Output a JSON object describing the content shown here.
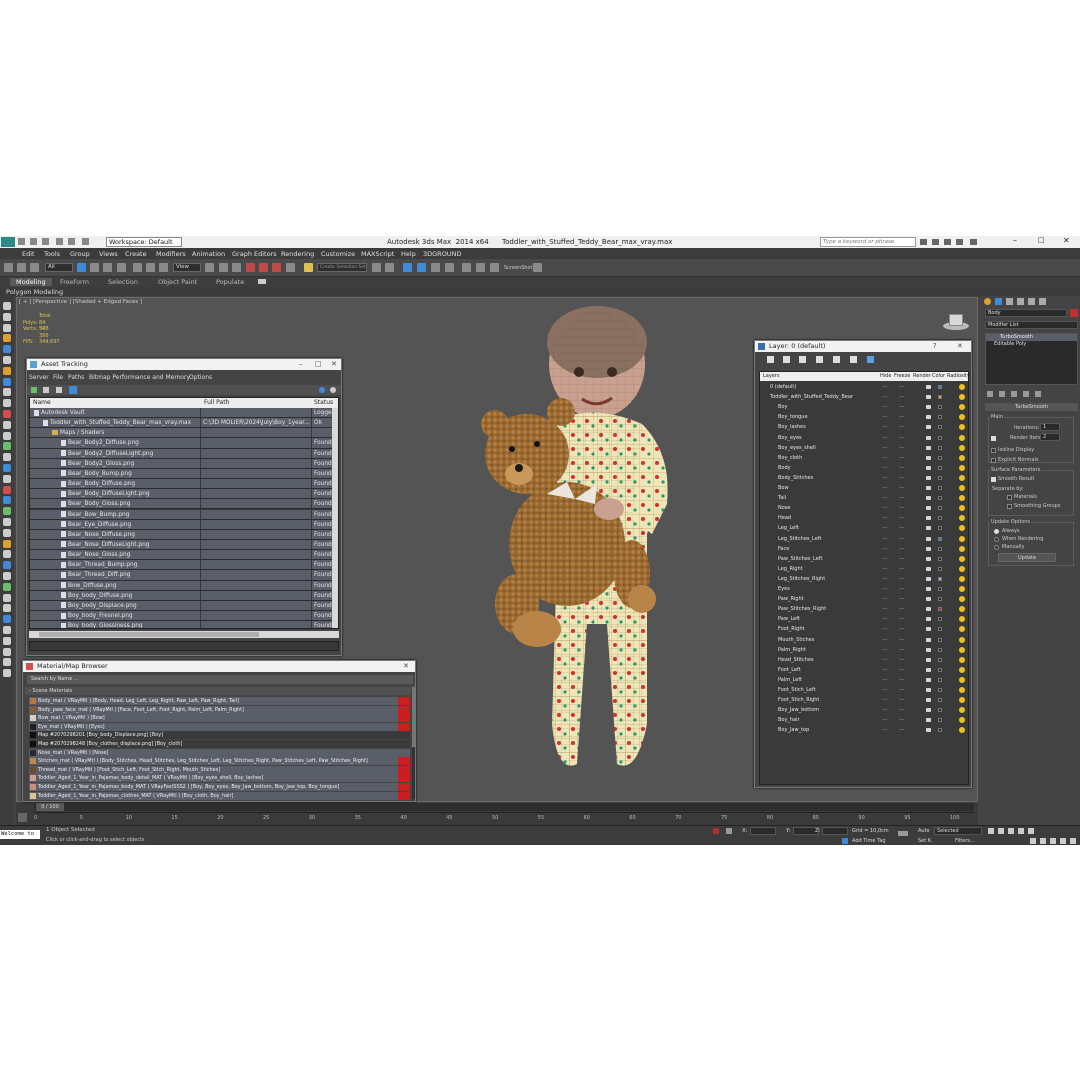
{
  "titlebar": {
    "title": "Autodesk 3ds Max  2014 x64      Toddler_with_Stuffed_Teddy_Bear_max_vray.max",
    "workspace": "Workspace: Default",
    "search_placeholder": "Type a keyword or phrase"
  },
  "menu": [
    "Edit",
    "Tools",
    "Group",
    "Views",
    "Create",
    "Modifiers",
    "Animation",
    "Graph Editors",
    "Rendering",
    "Customize",
    "MAXScript",
    "Help",
    "3DGROUND"
  ],
  "toolbar": {
    "filter": "All",
    "view": "View",
    "selection_set": "Create Selection Set",
    "screenshot": "ScreenShot"
  },
  "ribbon": {
    "tabs": [
      "Modeling",
      "Freeform",
      "Selection",
      "Object Paint",
      "Populate"
    ],
    "sub": "Polygon Modeling"
  },
  "viewport": {
    "label": "[ + ] [Perspective ] [Shaded + Edged Faces ]",
    "stats_total": "Total",
    "polys_label": "Polys:",
    "polys": "84 348",
    "verts_label": "Verts:",
    "verts": "57 386",
    "fps_label": "FPS:",
    "fps": "344,697"
  },
  "asset_tracking": {
    "title": "Asset Tracking",
    "menu": [
      "Server",
      "File",
      "Paths",
      "Bitmap Performance and Memory",
      "Options"
    ],
    "columns": [
      "Name",
      "Full Path",
      "Status"
    ],
    "rows": [
      {
        "name": "Autodesk Vault",
        "path": "",
        "status": "Logged",
        "indent": 0,
        "kind": "vault"
      },
      {
        "name": "Toddler_with_Stuffed_Teddy_Bear_max_vray.max",
        "path": "C:\\3D MOLIER\\2024\\July\\Boy_1year...",
        "status": "Ok",
        "indent": 1,
        "kind": "file"
      },
      {
        "name": "Maps / Shaders",
        "path": "",
        "status": "",
        "indent": 2,
        "kind": "folder"
      },
      {
        "name": "Bear_Body2_Diffuse.png",
        "path": "",
        "status": "Found",
        "indent": 3,
        "kind": "file"
      },
      {
        "name": "Bear_Body2_DiffuseLight.png",
        "path": "",
        "status": "Found",
        "indent": 3,
        "kind": "file"
      },
      {
        "name": "Bear_Body2_Gloss.png",
        "path": "",
        "status": "Found",
        "indent": 3,
        "kind": "file"
      },
      {
        "name": "Bear_Body_Bump.png",
        "path": "",
        "status": "Found",
        "indent": 3,
        "kind": "file"
      },
      {
        "name": "Bear_Body_Diffuse.png",
        "path": "",
        "status": "Found",
        "indent": 3,
        "kind": "file"
      },
      {
        "name": "Bear_Body_DiffuseLight.png",
        "path": "",
        "status": "Found",
        "indent": 3,
        "kind": "file"
      },
      {
        "name": "Bear_Body_Gloss.png",
        "path": "",
        "status": "Found",
        "indent": 3,
        "kind": "file"
      },
      {
        "name": "Bear_Bow_Bump.png",
        "path": "",
        "status": "Found",
        "indent": 3,
        "kind": "file"
      },
      {
        "name": "Bear_Eye_Diffuse.png",
        "path": "",
        "status": "Found",
        "indent": 3,
        "kind": "file"
      },
      {
        "name": "Bear_Nose_Diffuse.png",
        "path": "",
        "status": "Found",
        "indent": 3,
        "kind": "file"
      },
      {
        "name": "Bear_Nose_DiffuseLight.png",
        "path": "",
        "status": "Found",
        "indent": 3,
        "kind": "file"
      },
      {
        "name": "Bear_Nose_Gloss.png",
        "path": "",
        "status": "Found",
        "indent": 3,
        "kind": "file"
      },
      {
        "name": "Bear_Thread_Bump.png",
        "path": "",
        "status": "Found",
        "indent": 3,
        "kind": "file"
      },
      {
        "name": "Bear_Thread_Diff.png",
        "path": "",
        "status": "Found",
        "indent": 3,
        "kind": "file"
      },
      {
        "name": "Bow_Diffuse.png",
        "path": "",
        "status": "Found",
        "indent": 3,
        "kind": "file"
      },
      {
        "name": "Boy_body_Diffuse.png",
        "path": "",
        "status": "Found",
        "indent": 3,
        "kind": "file"
      },
      {
        "name": "Boy_body_Displace.png",
        "path": "",
        "status": "Found",
        "indent": 3,
        "kind": "file"
      },
      {
        "name": "Boy_body_Fresnel.png",
        "path": "",
        "status": "Found",
        "indent": 3,
        "kind": "file"
      },
      {
        "name": "Boy_body_Glossiness.png",
        "path": "",
        "status": "Found",
        "indent": 3,
        "kind": "file"
      },
      {
        "name": "Boy_body_Normal.png",
        "path": "",
        "status": "Found",
        "indent": 3,
        "kind": "file"
      }
    ]
  },
  "material_browser": {
    "title": "Material/Map Browser",
    "search_placeholder": "Search by Name ...",
    "section": "- Scene Materials",
    "rows": [
      {
        "text": "Body_mat ( VRayMtl ) [Body, Head, Leg_Left, Leg_Right, Paw_Left, Paw_Right, Tail]",
        "swatch": "#b8743a",
        "red": true
      },
      {
        "text": "Body_paw_face_mat ( VRayMtl ) [Face, Foot_Left, Foot_Right, Palm_Left, Palm_Right]",
        "swatch": "#8a5a30",
        "red": true
      },
      {
        "text": "Bow_mat ( VRayMtl ) [Bow]",
        "swatch": "#d8d0c8",
        "red": true
      },
      {
        "text": "Eye_mat ( VRayMtl ) [Eyes]",
        "swatch": "#202020",
        "red": true
      },
      {
        "text": "Map #2070298201 [Boy_body_Displace.png] [Boy]",
        "swatch": "#101010",
        "red": false
      },
      {
        "text": "Map #2070298248 [Boy_clothes_displace.png] [Boy_cloth]",
        "swatch": "#101010",
        "red": false
      },
      {
        "text": "Nose_mat ( VRayMtl ) [Nose]",
        "swatch": "#2a2a2a",
        "red": false
      },
      {
        "text": "Stitches_mat ( VRayMtl ) [Body_Stitches, Head_Stitches, Leg_Stitches_Left, Leg_Stitches_Right, Paw_Stitches_Left, Paw_Stitches_Right]",
        "swatch": "#c08848",
        "red": true
      },
      {
        "text": "Thread_mat ( VRayMtl ) [Foot_Stich_Left, Foot_Stich_Right, Mouth_Stiches]",
        "swatch": "#6a4a30",
        "red": true
      },
      {
        "text": "Toddler_Aged_1_Year_in_Pajamas_body_detail_MAT ( VRayMtl ) [Boy_eyes_shell, Boy_lashes]",
        "swatch": "#d0a090",
        "red": true
      },
      {
        "text": "Toddler_Aged_1_Year_in_Pajamas_body_MAT ( VRayFastSSS2 ) [Boy, Boy_eyes, Boy_Jaw_bottom, Boy_Jaw_top, Boy_tongue]",
        "swatch": "#c89080",
        "red": true
      },
      {
        "text": "Toddler_Aged_1_Year_in_Pajamas_clothes_MAT ( VRayMtl ) [Boy_cloth, Boy_hair]",
        "swatch": "#d8c890",
        "red": true
      }
    ]
  },
  "layers": {
    "title": "Layer: 0 (default)",
    "columns": [
      "Layers",
      "Hide",
      "Freeze",
      "Render",
      "Color",
      "Radiosity"
    ],
    "rows": [
      {
        "name": "0 (default)",
        "indent": 0,
        "color": "#3a78c8"
      },
      {
        "name": "Toddler_with_Stuffed_Teddy_Bear",
        "indent": 0,
        "color": "#e0a020"
      },
      {
        "name": "Boy",
        "indent": 1,
        "color": "#282828"
      },
      {
        "name": "Boy_tongue",
        "indent": 1,
        "color": "#282828"
      },
      {
        "name": "Boy_lashes",
        "indent": 1,
        "color": "#282828"
      },
      {
        "name": "Boy_eyes",
        "indent": 1,
        "color": "#282828"
      },
      {
        "name": "Boy_eyes_shell",
        "indent": 1,
        "color": "#282828"
      },
      {
        "name": "Boy_cloth",
        "indent": 1,
        "color": "#282828"
      },
      {
        "name": "Body",
        "indent": 1,
        "color": "#282828"
      },
      {
        "name": "Body_Stitches",
        "indent": 1,
        "color": "#282828"
      },
      {
        "name": "Bow",
        "indent": 1,
        "color": "#282828"
      },
      {
        "name": "Tail",
        "indent": 1,
        "color": "#282828"
      },
      {
        "name": "Nose",
        "indent": 1,
        "color": "#282828"
      },
      {
        "name": "Head",
        "indent": 1,
        "color": "#282828"
      },
      {
        "name": "Leg_Left",
        "indent": 1,
        "color": "#282828"
      },
      {
        "name": "Leg_Stitches_Left",
        "indent": 1,
        "color": "#3a78c8"
      },
      {
        "name": "Face",
        "indent": 1,
        "color": "#282828"
      },
      {
        "name": "Paw_Stitches_Left",
        "indent": 1,
        "color": "#282828"
      },
      {
        "name": "Leg_Right",
        "indent": 1,
        "color": "#282828"
      },
      {
        "name": "Leg_Stitches_Right",
        "indent": 1,
        "color": "#a0a8e8"
      },
      {
        "name": "Eyes",
        "indent": 1,
        "color": "#282828"
      },
      {
        "name": "Paw_Right",
        "indent": 1,
        "color": "#282828"
      },
      {
        "name": "Paw_Stitches_Right",
        "indent": 1,
        "color": "#c02040"
      },
      {
        "name": "Paw_Left",
        "indent": 1,
        "color": "#282828"
      },
      {
        "name": "Foot_Right",
        "indent": 1,
        "color": "#282828"
      },
      {
        "name": "Mouth_Stiches",
        "indent": 1,
        "color": "#282828"
      },
      {
        "name": "Palm_Right",
        "indent": 1,
        "color": "#282828"
      },
      {
        "name": "Head_Stitches",
        "indent": 1,
        "color": "#282828"
      },
      {
        "name": "Foot_Left",
        "indent": 1,
        "color": "#282828"
      },
      {
        "name": "Palm_Left",
        "indent": 1,
        "color": "#282828"
      },
      {
        "name": "Foot_Stich_Left",
        "indent": 1,
        "color": "#282828"
      },
      {
        "name": "Foot_Stich_Right",
        "indent": 1,
        "color": "#282828"
      },
      {
        "name": "Boy_Jaw_bottom",
        "indent": 1,
        "color": "#282828"
      },
      {
        "name": "Boy_hair",
        "indent": 1,
        "color": "#282828"
      },
      {
        "name": "Boy_Jaw_top",
        "indent": 1,
        "color": "#282828"
      }
    ]
  },
  "command_panel": {
    "object_name": "Body",
    "modifier_list": "Modifier List",
    "stack": [
      "TurboSmooth",
      "Editable Poly"
    ],
    "rollout": "TurboSmooth",
    "main": "Main",
    "iterations_label": "Iterations:",
    "iterations": "1",
    "render_iters_label": "Render Iters:",
    "render_iters": "2",
    "isoline": "Isoline Display",
    "explicit": "Explicit Normals",
    "surface_params": "Surface Parameters",
    "smooth_result": "Smooth Result",
    "separate_by": "Separate by:",
    "materials": "Materials",
    "smoothing_groups": "Smoothing Groups",
    "update_options": "Update Options",
    "always": "Always",
    "when_rendering": "When Rendering",
    "manually": "Manually",
    "update_btn": "Update"
  },
  "timeline": {
    "frame": "0 / 100",
    "ticks": [
      "0",
      "5",
      "10",
      "15",
      "20",
      "25",
      "30",
      "35",
      "40",
      "45",
      "50",
      "55",
      "60",
      "65",
      "70",
      "75",
      "80",
      "85",
      "90",
      "95",
      "100"
    ]
  },
  "status": {
    "selected": "1 Object Selected",
    "hint": "Click or click-and-drag to select objects",
    "welcome": "Welcome to",
    "x_label": "X:",
    "y_label": "Y:",
    "z_label": "Z:",
    "grid": "Grid = 10,0cm",
    "add_time_tag": "Add Time Tag",
    "auto": "Auto",
    "selected_dd": "Selected",
    "set_k": "Set K.",
    "filters": "Filters..."
  }
}
